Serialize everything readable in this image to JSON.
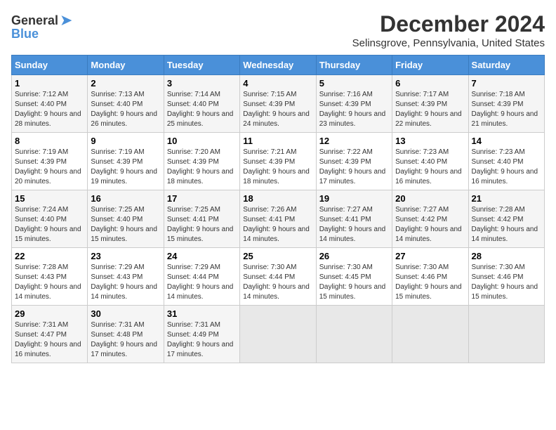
{
  "logo": {
    "general": "General",
    "blue": "Blue"
  },
  "title": "December 2024",
  "location": "Selinsgrove, Pennsylvania, United States",
  "days_of_week": [
    "Sunday",
    "Monday",
    "Tuesday",
    "Wednesday",
    "Thursday",
    "Friday",
    "Saturday"
  ],
  "weeks": [
    [
      {
        "day": "1",
        "sunrise": "7:12 AM",
        "sunset": "4:40 PM",
        "daylight": "9 hours and 28 minutes."
      },
      {
        "day": "2",
        "sunrise": "7:13 AM",
        "sunset": "4:40 PM",
        "daylight": "9 hours and 26 minutes."
      },
      {
        "day": "3",
        "sunrise": "7:14 AM",
        "sunset": "4:40 PM",
        "daylight": "9 hours and 25 minutes."
      },
      {
        "day": "4",
        "sunrise": "7:15 AM",
        "sunset": "4:39 PM",
        "daylight": "9 hours and 24 minutes."
      },
      {
        "day": "5",
        "sunrise": "7:16 AM",
        "sunset": "4:39 PM",
        "daylight": "9 hours and 23 minutes."
      },
      {
        "day": "6",
        "sunrise": "7:17 AM",
        "sunset": "4:39 PM",
        "daylight": "9 hours and 22 minutes."
      },
      {
        "day": "7",
        "sunrise": "7:18 AM",
        "sunset": "4:39 PM",
        "daylight": "9 hours and 21 minutes."
      }
    ],
    [
      {
        "day": "8",
        "sunrise": "7:19 AM",
        "sunset": "4:39 PM",
        "daylight": "9 hours and 20 minutes."
      },
      {
        "day": "9",
        "sunrise": "7:19 AM",
        "sunset": "4:39 PM",
        "daylight": "9 hours and 19 minutes."
      },
      {
        "day": "10",
        "sunrise": "7:20 AM",
        "sunset": "4:39 PM",
        "daylight": "9 hours and 18 minutes."
      },
      {
        "day": "11",
        "sunrise": "7:21 AM",
        "sunset": "4:39 PM",
        "daylight": "9 hours and 18 minutes."
      },
      {
        "day": "12",
        "sunrise": "7:22 AM",
        "sunset": "4:39 PM",
        "daylight": "9 hours and 17 minutes."
      },
      {
        "day": "13",
        "sunrise": "7:23 AM",
        "sunset": "4:40 PM",
        "daylight": "9 hours and 16 minutes."
      },
      {
        "day": "14",
        "sunrise": "7:23 AM",
        "sunset": "4:40 PM",
        "daylight": "9 hours and 16 minutes."
      }
    ],
    [
      {
        "day": "15",
        "sunrise": "7:24 AM",
        "sunset": "4:40 PM",
        "daylight": "9 hours and 15 minutes."
      },
      {
        "day": "16",
        "sunrise": "7:25 AM",
        "sunset": "4:40 PM",
        "daylight": "9 hours and 15 minutes."
      },
      {
        "day": "17",
        "sunrise": "7:25 AM",
        "sunset": "4:41 PM",
        "daylight": "9 hours and 15 minutes."
      },
      {
        "day": "18",
        "sunrise": "7:26 AM",
        "sunset": "4:41 PM",
        "daylight": "9 hours and 14 minutes."
      },
      {
        "day": "19",
        "sunrise": "7:27 AM",
        "sunset": "4:41 PM",
        "daylight": "9 hours and 14 minutes."
      },
      {
        "day": "20",
        "sunrise": "7:27 AM",
        "sunset": "4:42 PM",
        "daylight": "9 hours and 14 minutes."
      },
      {
        "day": "21",
        "sunrise": "7:28 AM",
        "sunset": "4:42 PM",
        "daylight": "9 hours and 14 minutes."
      }
    ],
    [
      {
        "day": "22",
        "sunrise": "7:28 AM",
        "sunset": "4:43 PM",
        "daylight": "9 hours and 14 minutes."
      },
      {
        "day": "23",
        "sunrise": "7:29 AM",
        "sunset": "4:43 PM",
        "daylight": "9 hours and 14 minutes."
      },
      {
        "day": "24",
        "sunrise": "7:29 AM",
        "sunset": "4:44 PM",
        "daylight": "9 hours and 14 minutes."
      },
      {
        "day": "25",
        "sunrise": "7:30 AM",
        "sunset": "4:44 PM",
        "daylight": "9 hours and 14 minutes."
      },
      {
        "day": "26",
        "sunrise": "7:30 AM",
        "sunset": "4:45 PM",
        "daylight": "9 hours and 15 minutes."
      },
      {
        "day": "27",
        "sunrise": "7:30 AM",
        "sunset": "4:46 PM",
        "daylight": "9 hours and 15 minutes."
      },
      {
        "day": "28",
        "sunrise": "7:30 AM",
        "sunset": "4:46 PM",
        "daylight": "9 hours and 15 minutes."
      }
    ],
    [
      {
        "day": "29",
        "sunrise": "7:31 AM",
        "sunset": "4:47 PM",
        "daylight": "9 hours and 16 minutes."
      },
      {
        "day": "30",
        "sunrise": "7:31 AM",
        "sunset": "4:48 PM",
        "daylight": "9 hours and 17 minutes."
      },
      {
        "day": "31",
        "sunrise": "7:31 AM",
        "sunset": "4:49 PM",
        "daylight": "9 hours and 17 minutes."
      },
      null,
      null,
      null,
      null
    ]
  ]
}
